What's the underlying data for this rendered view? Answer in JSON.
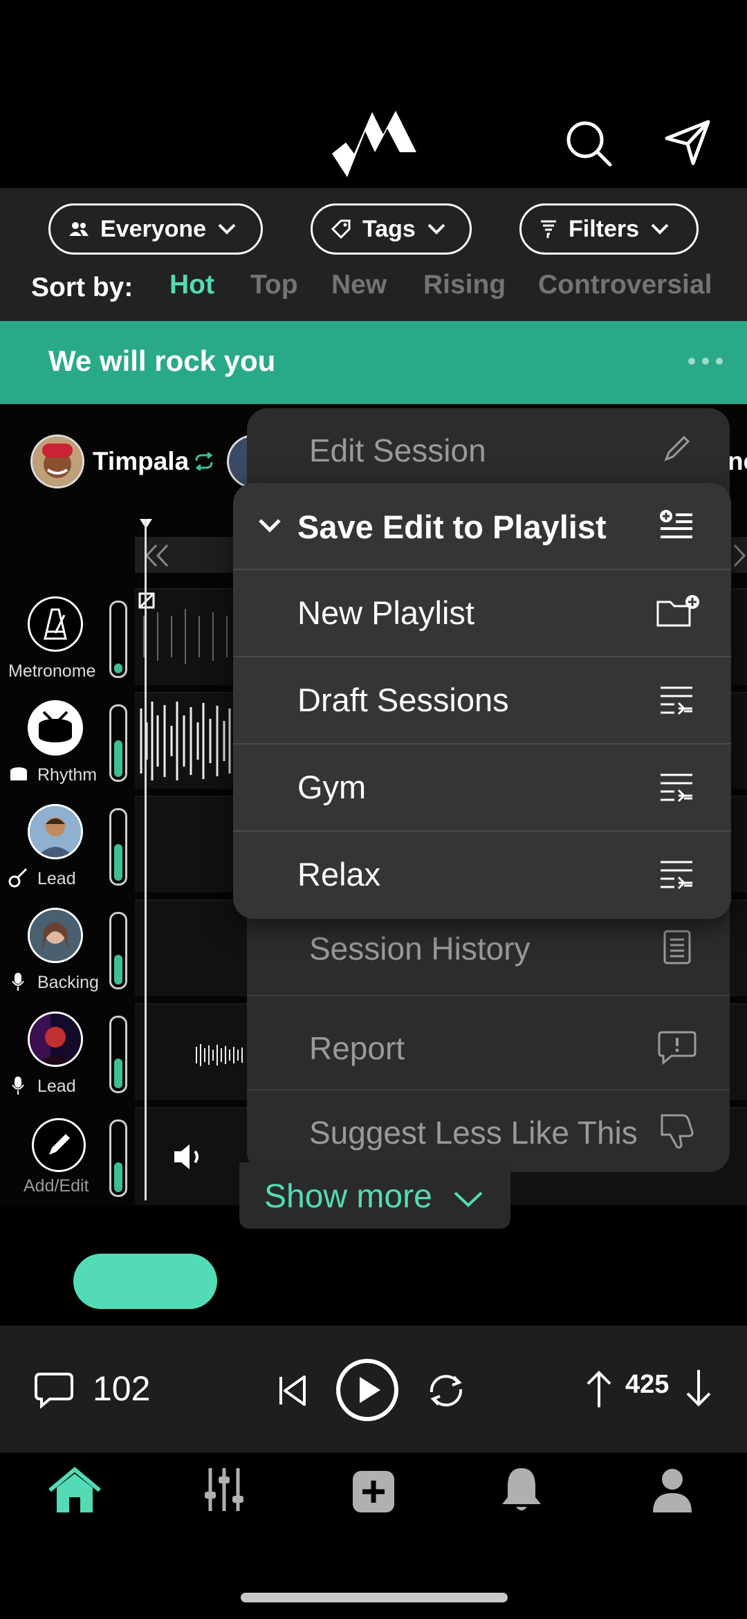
{
  "filters": {
    "audience": "Everyone",
    "tags": "Tags",
    "filters": "Filters"
  },
  "sort": {
    "label": "Sort by:",
    "options": [
      "Hot",
      "Top",
      "New",
      "Rising",
      "Controversial"
    ],
    "active": "Hot"
  },
  "session": {
    "title": "We will rock you",
    "creator": "Timpala",
    "partial_name": "ne"
  },
  "tracks": [
    {
      "label": "Metronome",
      "level": 0.15
    },
    {
      "label": "Rhythm",
      "level": 0.55
    },
    {
      "label": "Lead",
      "level": 0.55
    },
    {
      "label": "Backing",
      "level": 0.45
    },
    {
      "label": "Lead",
      "level": 0.45
    },
    {
      "label": "Add/Edit",
      "level": 0.45
    }
  ],
  "menu": {
    "items": [
      "Edit Session",
      "Session History",
      "Report",
      "Suggest Less Like This"
    ],
    "submenu_title": "Save Edit to Playlist",
    "submenu_items": [
      "New Playlist",
      "Draft Sessions",
      "Gym",
      "Relax"
    ],
    "show_more": "Show more"
  },
  "player": {
    "comments": "102",
    "votes": "425"
  },
  "colors": {
    "accent": "#53dbb6",
    "banner": "#2aa988"
  }
}
